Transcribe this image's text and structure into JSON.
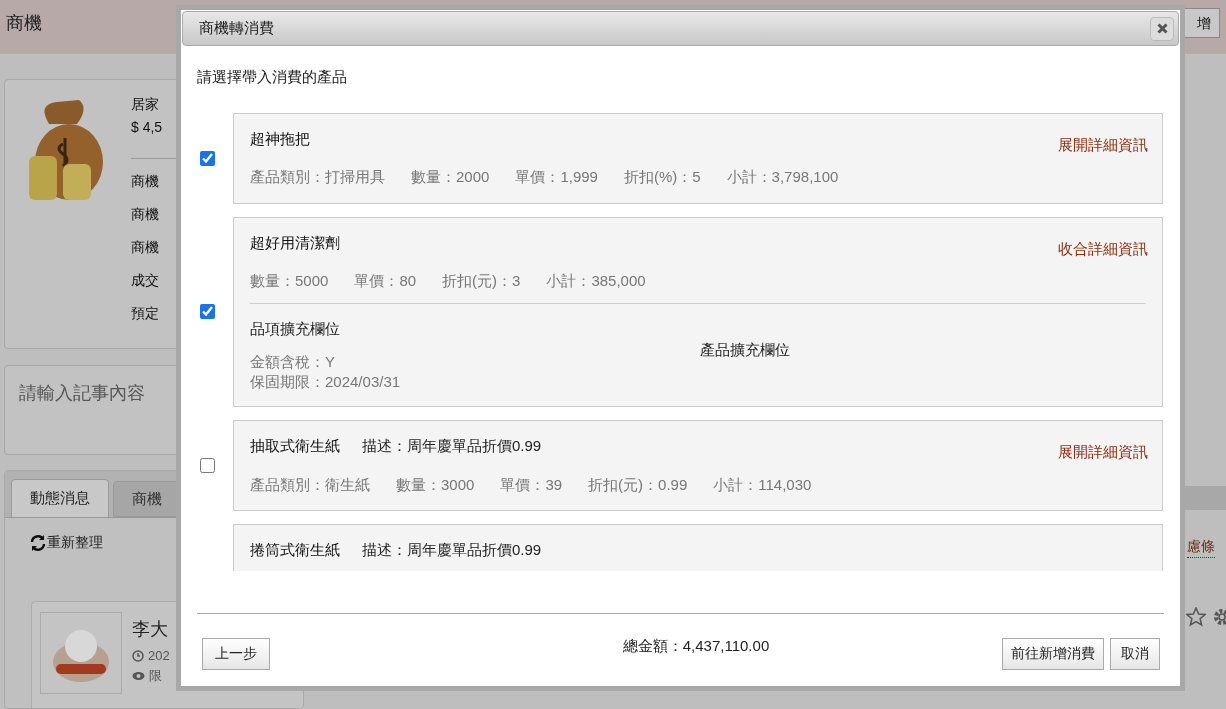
{
  "header": {
    "title": "商機",
    "button": "增"
  },
  "opportunity": {
    "name": "居家",
    "amount": "$ 4,5",
    "fields": [
      "商機",
      "商機",
      "商機",
      "成交",
      "預定"
    ]
  },
  "note": {
    "placeholder": "請輸入記事內容"
  },
  "tabs": [
    {
      "label": "動態消息",
      "selected": true
    },
    {
      "label": "商機",
      "selected": false
    }
  ],
  "refresh": "重新整理",
  "filter_link": "慮條",
  "post": {
    "author": "李大",
    "time": "202",
    "visibility": "限"
  },
  "dialog": {
    "title": "商機轉消費",
    "prompt": "請選擇帶入消費的產品",
    "items": [
      {
        "name": "超神拖把",
        "checked": true,
        "expanded": false,
        "toggle": "展開詳細資訊",
        "fields": [
          "產品類別：打掃用具",
          "數量：2000",
          "單價：1,999",
          "折扣(%)：5",
          "小計：3,798,100"
        ]
      },
      {
        "name": "超好用清潔劑",
        "checked": true,
        "expanded": true,
        "toggle": "收合詳細資訊",
        "fields": [
          "數量：5000",
          "單價：80",
          "折扣(元)：3",
          "小計：385,000"
        ],
        "details": {
          "item_heading": "品項擴充欄位",
          "item_fields": [
            "金額含稅：Y",
            "保固期限：2024/03/31"
          ],
          "product_heading": "產品擴充欄位"
        }
      },
      {
        "name": "抽取式衛生紙",
        "description": "描述：周年慶單品折價0.99",
        "checked": false,
        "expanded": false,
        "toggle": "展開詳細資訊",
        "fields": [
          "產品類別：衛生紙",
          "數量：3000",
          "單價：39",
          "折扣(元)：0.99",
          "小計：114,030"
        ]
      },
      {
        "name": "捲筒式衛生紙",
        "description": "描述：周年慶單品折價0.99"
      }
    ],
    "total": "總金額：4,437,110.00",
    "back_button": "上一步",
    "go_button": "前往新增消費",
    "cancel_button": "取消"
  }
}
